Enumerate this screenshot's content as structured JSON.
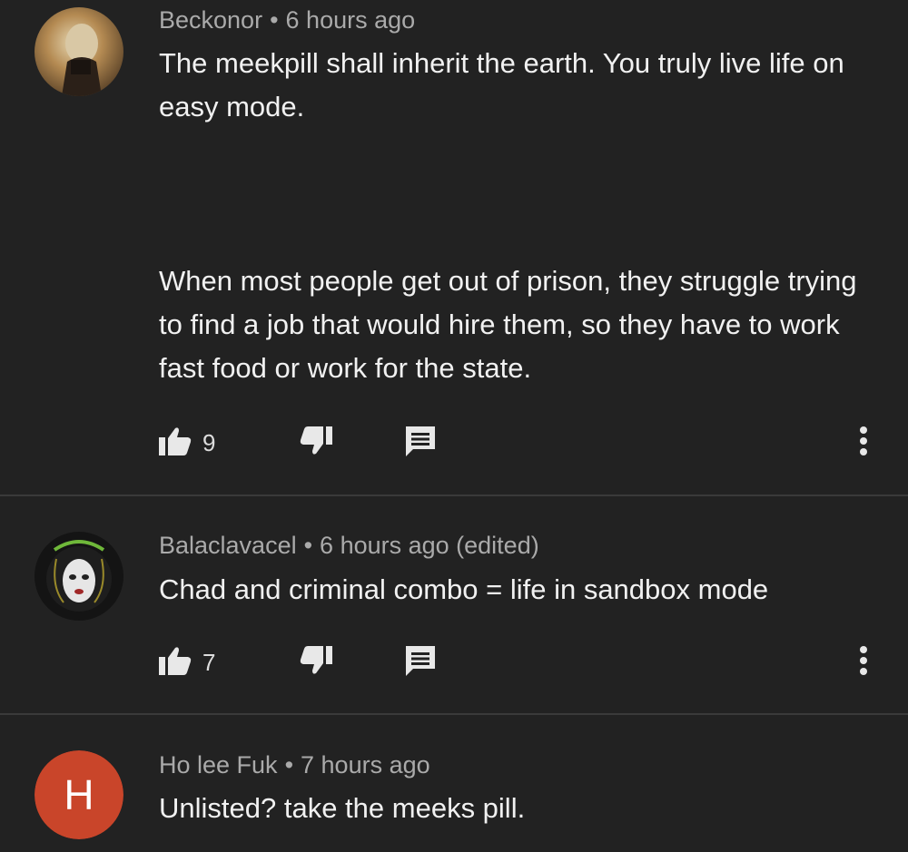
{
  "comments": [
    {
      "author": "Beckonor",
      "time": "6 hours ago",
      "avatar_icon": "user-photo-avatar",
      "paragraphs": [
        "The meekpill shall inherit the earth. You truly live life on easy mode.",
        "When most people get out of prison, they struggle trying to find a job that would hire them, so they have to work fast food or work for the state."
      ],
      "likes": "9"
    },
    {
      "author": "Balaclavacel",
      "time": "6 hours ago (edited)",
      "avatar_icon": "balaclava-avatar",
      "paragraphs": [
        "Chad and criminal combo = life in sandbox mode"
      ],
      "likes": "7"
    },
    {
      "author": "Ho lee Fuk",
      "time": "7 hours ago",
      "avatar_letter": "H",
      "avatar_color": "#c9452a",
      "paragraphs": [
        "Unlisted? take the meeks pill."
      ]
    }
  ],
  "separator": "•",
  "icons": {
    "like": "thumbs-up-icon",
    "dislike": "thumbs-down-icon",
    "reply": "reply-icon",
    "more": "more-vertical-icon"
  }
}
